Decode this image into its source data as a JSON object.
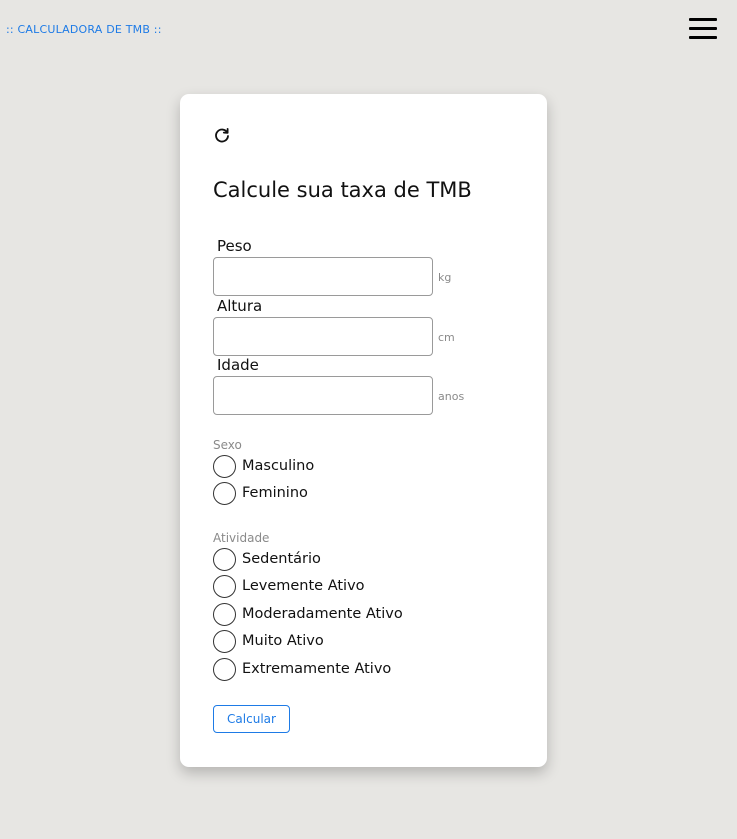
{
  "header": {
    "brand": ":: CALCULADORA DE TMB ::",
    "menu_icon": "hamburger-menu-icon"
  },
  "card": {
    "reset_icon": "refresh-icon",
    "title": "Calcule sua taxa de TMB",
    "fields": [
      {
        "label": "Peso",
        "unit": "kg",
        "value": "",
        "placeholder": ""
      },
      {
        "label": "Altura",
        "unit": "cm",
        "value": "",
        "placeholder": ""
      },
      {
        "label": "Idade",
        "unit": "anos",
        "value": "",
        "placeholder": ""
      }
    ],
    "sex": {
      "label": "Sexo",
      "options": [
        "Masculino",
        "Feminino"
      ],
      "selected": null
    },
    "activity": {
      "label": "Atividade",
      "options": [
        "Sedentário",
        "Levemente Ativo",
        "Moderadamente Ativo",
        "Muito Ativo",
        "Extremamente Ativo"
      ],
      "selected": null
    },
    "submit_label": "Calcular"
  },
  "colors": {
    "accent": "#1e7be6",
    "background": "#e7e6e3",
    "card": "#ffffff"
  }
}
